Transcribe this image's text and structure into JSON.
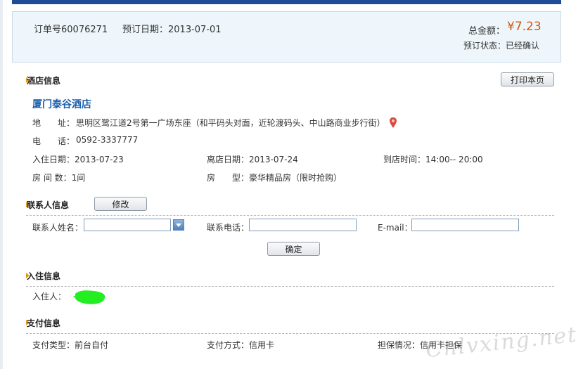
{
  "order": {
    "number": "订单号60076271",
    "date": "预订日期：2013-07-01",
    "total_label": "总金额：",
    "total_value": "¥7.23",
    "status": "预订状态：已经确认"
  },
  "hotel_section": {
    "title": "酒店信息",
    "print_button": "打印本页",
    "hotel_name": "厦门泰谷酒店",
    "address_label": "地　　址：",
    "address": "思明区鹭江道2号第一广场东座（和平码头对面，近轮渡码头、中山路商业步行街）",
    "phone_label": "电　　话：",
    "phone": "0592-3337777",
    "checkin": "入住日期：2013-07-23",
    "checkout": "离店日期：2013-07-24",
    "arrival": "到店时间：14:00-- 20:00",
    "rooms": "房 间 数：1间",
    "room_type": "房　　型：豪华精品房（限时抢购）"
  },
  "contact_section": {
    "title": "联系人信息",
    "modify_button": "修改",
    "name_label": "联系人姓名：",
    "name_value": "",
    "phone_label": "联系电话：",
    "phone_value": "",
    "email_label": "E-mail：",
    "email_value": "",
    "confirm_button": "确定"
  },
  "guest_section": {
    "title": "入住信息",
    "guest_label": "入住人："
  },
  "payment_section": {
    "title": "支付信息",
    "pay_type": "支付类型：前台自付",
    "pay_method": "支付方式：信用卡",
    "guarantee": "担保情况：信用卡担保"
  },
  "watermark_text": "Cnlvxing.net",
  "colors": {
    "accent_blue": "#1b5fae",
    "price_orange": "#d25a10",
    "section_arrow": "#e39a1c",
    "top_bar": "#1f4e97"
  }
}
